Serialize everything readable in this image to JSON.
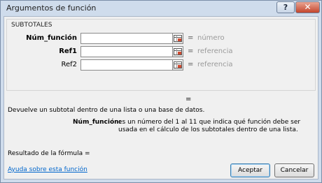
{
  "window": {
    "title": "Argumentos de función",
    "help_label": "?",
    "close_label": "✕"
  },
  "group": {
    "title": "SUBTOTALES",
    "args": [
      {
        "label": "Núm_función",
        "bold": true,
        "value": "",
        "result": "número"
      },
      {
        "label": "Ref1",
        "bold": true,
        "value": "",
        "result": "referencia"
      },
      {
        "label": "Ref2",
        "bold": false,
        "value": "",
        "result": "referencia"
      }
    ],
    "equals": "="
  },
  "formula_equals": "=",
  "description": "Devuelve un subtotal dentro de una lista o una base de datos.",
  "param_help": {
    "name": "Núm_función:",
    "text": "es un número del 1 al 11 que indica qué función debe ser usada en el cálculo de los subtotales dentro de una lista."
  },
  "result_label": "Resultado de la fórmula =",
  "help_link": "Ayuda sobre esta función",
  "buttons": {
    "ok": "Aceptar",
    "cancel": "Cancelar"
  },
  "icons": {
    "ref_button": "collapse-dialog-icon",
    "help": "help-icon",
    "close": "close-icon"
  }
}
